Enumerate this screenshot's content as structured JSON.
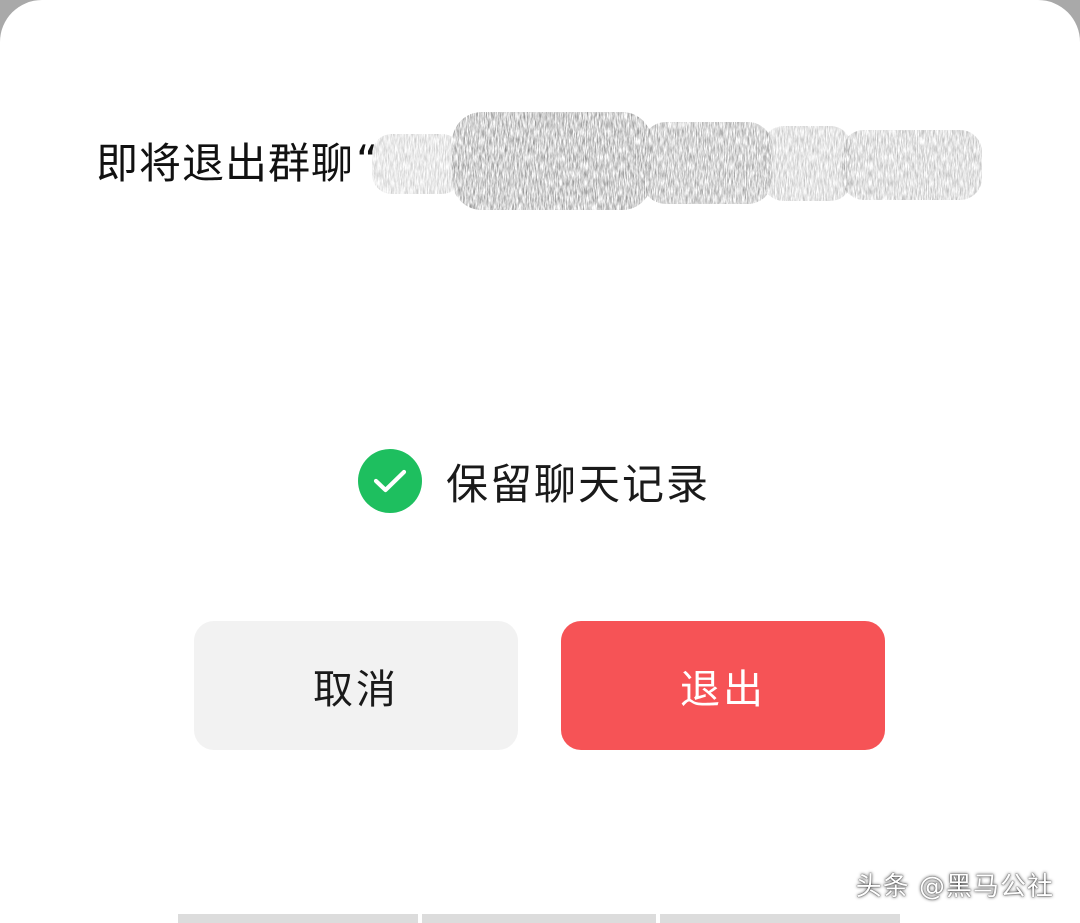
{
  "dialog": {
    "title_prefix": "即将退出群聊",
    "quote_open": "“",
    "group_name_redacted": true,
    "keep_history_label": "保留聊天记录",
    "keep_history_checked": true,
    "cancel_label": "取消",
    "exit_label": "退出"
  },
  "watermark": {
    "text": "头条 @黑马公社"
  },
  "colors": {
    "check_green": "#1ebf5f",
    "exit_red": "#f65356",
    "cancel_bg": "#f2f2f2"
  }
}
